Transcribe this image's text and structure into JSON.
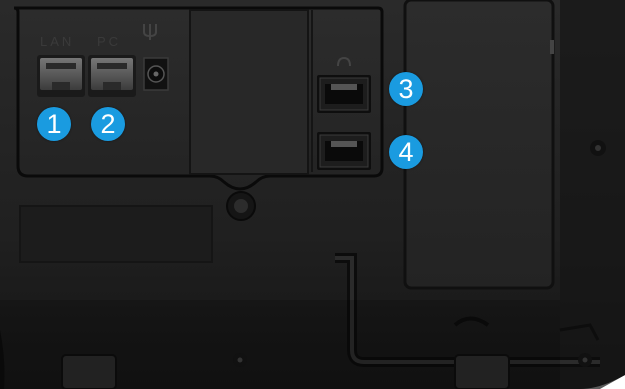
{
  "photo": {
    "subject": "phone-rear-panel",
    "labels": {
      "lan": "LAN",
      "pc": "PC"
    },
    "icons": {
      "power": "power-dc-icon",
      "headset": "headset-icon"
    },
    "badges": [
      {
        "number": "1",
        "color": "#1a9be0"
      },
      {
        "number": "2",
        "color": "#1a9be0"
      },
      {
        "number": "3",
        "color": "#1a9be0"
      },
      {
        "number": "4",
        "color": "#1a9be0"
      }
    ],
    "colors": {
      "body": "#1e1e1e",
      "panel": "#262626",
      "outline": "#0d0d0d",
      "badge": "#1a9be0"
    }
  }
}
